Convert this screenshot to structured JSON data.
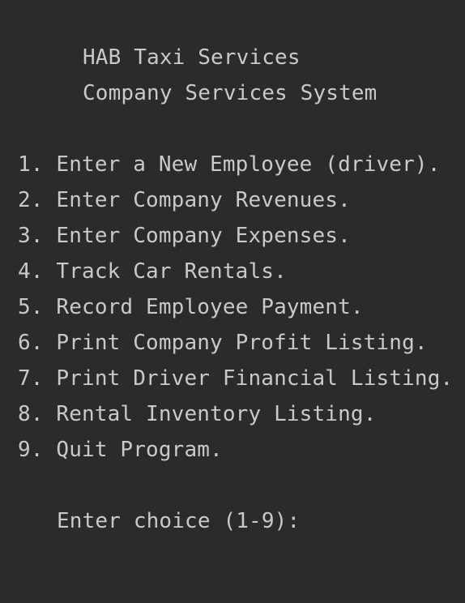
{
  "header": {
    "title": "HAB Taxi Services",
    "subtitle": "Company Services System"
  },
  "menu": {
    "items": [
      {
        "label": "1. Enter a New Employee (driver)."
      },
      {
        "label": "2. Enter Company Revenues."
      },
      {
        "label": "3. Enter Company Expenses."
      },
      {
        "label": "4. Track Car Rentals."
      },
      {
        "label": "5. Record Employee Payment."
      },
      {
        "label": "6. Print Company Profit Listing."
      },
      {
        "label": "7. Print Driver Financial Listing."
      },
      {
        "label": "8. Rental Inventory Listing."
      },
      {
        "label": "9. Quit Program."
      }
    ]
  },
  "prompt": {
    "text": "Enter choice (1-9):"
  },
  "colors": {
    "background": "#2b2b2b",
    "text": "#c9c9c9"
  }
}
